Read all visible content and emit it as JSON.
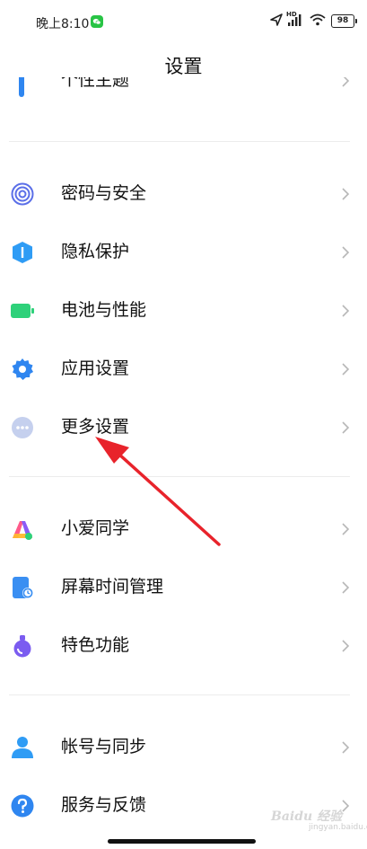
{
  "status_bar": {
    "time": "晚上8:10",
    "network": "HD",
    "battery": "98"
  },
  "header": {
    "title": "设置"
  },
  "partial_item": {
    "label": "个性主题"
  },
  "sections": [
    {
      "items": [
        {
          "label": "密码与安全",
          "icon": "fingerprint-icon",
          "color": "#5b6fe8"
        },
        {
          "label": "隐私保护",
          "icon": "privacy-shield-icon",
          "color": "#2f9cf5"
        },
        {
          "label": "电池与性能",
          "icon": "battery-icon",
          "color": "#2ed17a"
        },
        {
          "label": "应用设置",
          "icon": "gear-icon",
          "color": "#2f86f0"
        },
        {
          "label": "更多设置",
          "icon": "more-dots-icon",
          "color": "#b9c6ea"
        }
      ]
    },
    {
      "items": [
        {
          "label": "小爱同学",
          "icon": "xiaoai-icon",
          "color": "#ff5a8a"
        },
        {
          "label": "屏幕时间管理",
          "icon": "screen-time-icon",
          "color": "#3a8ff2"
        },
        {
          "label": "特色功能",
          "icon": "feature-flask-icon",
          "color": "#7b5cf0"
        }
      ]
    },
    {
      "items": [
        {
          "label": "帐号与同步",
          "icon": "account-icon",
          "color": "#2f9cf5"
        },
        {
          "label": "服务与反馈",
          "icon": "help-icon",
          "color": "#2f86f0"
        }
      ]
    }
  ],
  "watermark": {
    "text": "Baidu 经验",
    "sub": "jingyan.baidu.com"
  },
  "annotation": {
    "arrow_color": "#e8232b"
  }
}
